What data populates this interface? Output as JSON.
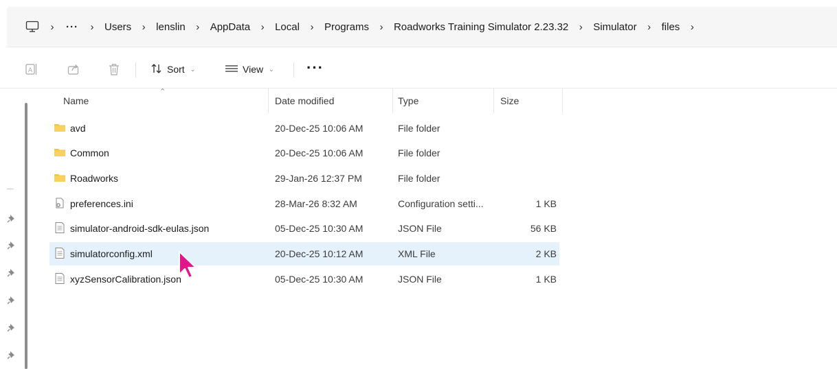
{
  "address": {
    "crumbs": [
      "Users",
      "lenslin",
      "AppData",
      "Local",
      "Programs",
      "Roadworks Training Simulator 2.23.32",
      "Simulator",
      "files"
    ],
    "ellipsis": "···",
    "separator": "›"
  },
  "toolbar": {
    "sort_label": "Sort",
    "view_label": "View",
    "more_label": "···"
  },
  "columns": {
    "name": "Name",
    "date": "Date modified",
    "type": "Type",
    "size": "Size"
  },
  "files": [
    {
      "name": "avd",
      "date": "20-Dec-25 10:06 AM",
      "type": "File folder",
      "size": "",
      "icon": "folder-icon"
    },
    {
      "name": "Common",
      "date": "20-Dec-25 10:06 AM",
      "type": "File folder",
      "size": "",
      "icon": "folder-icon"
    },
    {
      "name": "Roadworks",
      "date": "29-Jan-26 12:37 PM",
      "type": "File folder",
      "size": "",
      "icon": "folder-icon"
    },
    {
      "name": "preferences.ini",
      "date": "28-Mar-26 8:32 AM",
      "type": "Configuration setti...",
      "size": "1 KB",
      "icon": "settings-file-icon"
    },
    {
      "name": "simulator-android-sdk-eulas.json",
      "date": "05-Dec-25 10:30 AM",
      "type": "JSON File",
      "size": "56 KB",
      "icon": "document-icon"
    },
    {
      "name": "simulatorconfig.xml",
      "date": "20-Dec-25 10:12 AM",
      "type": "XML File",
      "size": "2 KB",
      "icon": "document-icon",
      "selected": true
    },
    {
      "name": "xyzSensorCalibration.json",
      "date": "05-Dec-25 10:30 AM",
      "type": "JSON File",
      "size": "1 KB",
      "icon": "document-icon"
    }
  ],
  "colors": {
    "selection": "#e5f1fb",
    "folder": "#f4c542",
    "cursor": "#e2168a"
  }
}
